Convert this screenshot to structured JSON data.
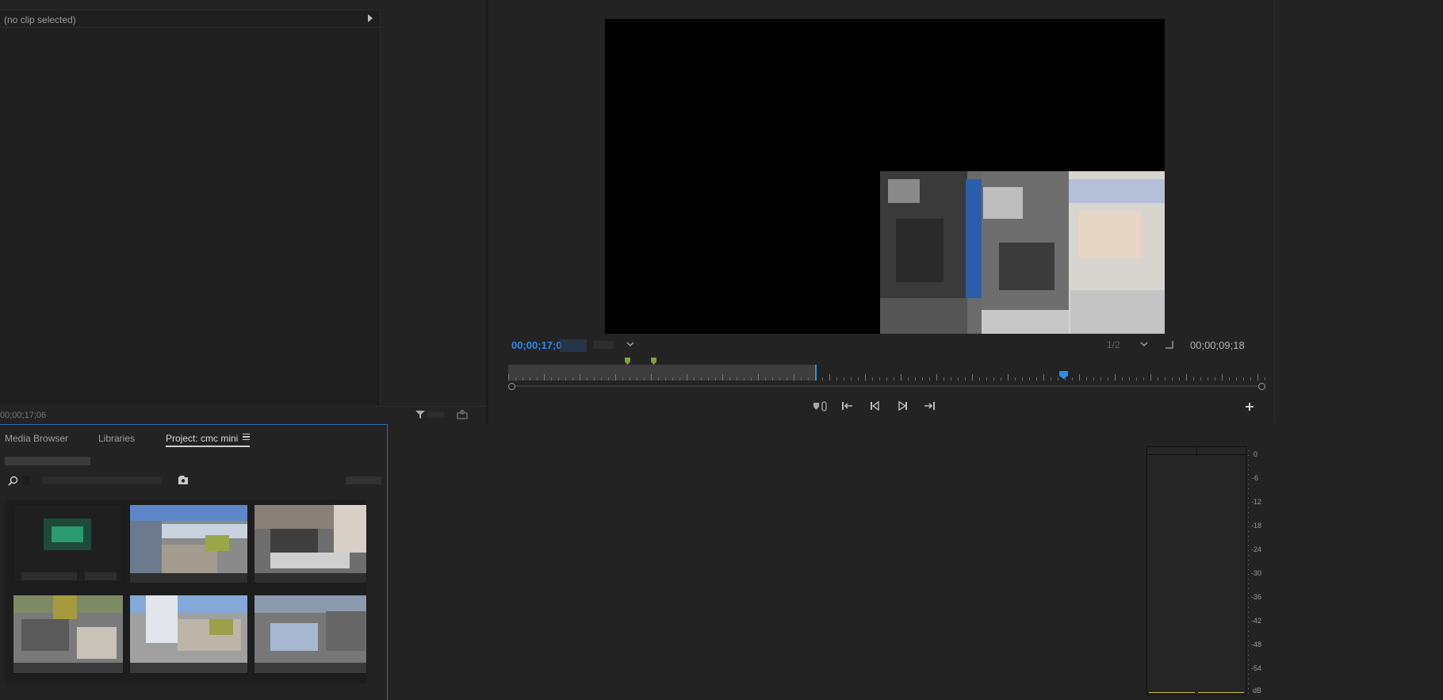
{
  "effect_controls": {
    "header_text": "(no clip selected)",
    "timecode": "00;00;17;06"
  },
  "program_monitor": {
    "current_timecode": "00;00;17;0",
    "duration_timecode": "00;00;09;18",
    "resolution": "1/2"
  },
  "project_panel": {
    "tabs": [
      {
        "label": "Media Browser"
      },
      {
        "label": "Libraries"
      },
      {
        "label": "Project: cmc mini"
      }
    ]
  },
  "audio_meter": {
    "labels": [
      "0",
      "-6",
      "-12",
      "-18",
      "-24",
      "-30",
      "-36",
      "-42",
      "-48",
      "-54",
      "dB"
    ]
  },
  "icons": {
    "play_triangle": "play-arrow-icon",
    "filter": "filter-icon",
    "export": "export-frame-icon",
    "search": "search-icon",
    "new_bin": "new-bin-icon",
    "menu": "hamburger-menu-icon",
    "marker_in": "step-back-to-in-icon",
    "step_back": "step-back-icon",
    "play": "play-icon",
    "step_forward": "step-forward-icon",
    "go_out": "go-to-out-icon",
    "add": "plus-icon"
  },
  "colors": {
    "accent_blue": "#2d8ceb",
    "marker_green": "#7fa33a",
    "meter_yellow": "#c8b842"
  }
}
